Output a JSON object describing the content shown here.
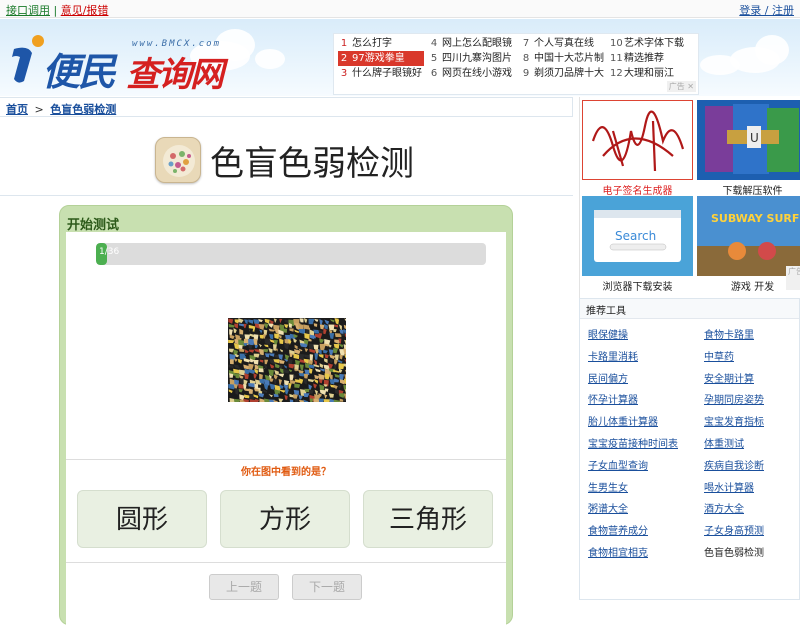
{
  "topbar": {
    "api_label": "接口调用",
    "sep": "|",
    "report_label": "意见/报错",
    "login_label": "登录 / 注册"
  },
  "header": {
    "logo_url_text": "www.BMCX.com",
    "logo_word1": "便民",
    "logo_word2": "查询网",
    "hot": [
      {
        "num": "1",
        "text": "怎么打字"
      },
      {
        "num": "2",
        "text": "97游戏拳皇"
      },
      {
        "num": "3",
        "text": "什么牌子眼镜好"
      },
      {
        "num": "4",
        "text": "网上怎么配眼镜"
      },
      {
        "num": "5",
        "text": "四川九寨沟图片"
      },
      {
        "num": "6",
        "text": "网页在线小游戏"
      },
      {
        "num": "7",
        "text": "个人写真在线"
      },
      {
        "num": "8",
        "text": "中国十大芯片制"
      },
      {
        "num": "9",
        "text": "剃须刀品牌十大"
      },
      {
        "num": "10",
        "text": "艺术字体下载"
      },
      {
        "num": "11",
        "text": "精选推荐"
      },
      {
        "num": "12",
        "text": "大理和丽江"
      }
    ],
    "ad_flag": "广告 ✕"
  },
  "breadcrumb": {
    "home": "首页",
    "sep": ">",
    "current": "色盲色弱检测"
  },
  "page": {
    "title": "色盲色弱检测"
  },
  "test": {
    "heading": "开始测试",
    "progress_text": "1/36",
    "progress_fraction": 0.028,
    "question": "你在图中看到的是？",
    "answers": [
      "圆形",
      "方形",
      "三角形"
    ],
    "prev_label": "上一题",
    "next_label": "下一题"
  },
  "sidebar": {
    "thumbs": [
      {
        "caption": "电子签名生成器",
        "highlight": true
      },
      {
        "caption": "下载解压软件",
        "highlight": false
      },
      {
        "caption": "浏览器下载安装",
        "highlight": false
      },
      {
        "caption": "游戏 开发",
        "highlight": false
      }
    ],
    "browser_search_text": "Search",
    "game_text": "SUBWAY SURFERS",
    "ad_flag": "广告",
    "tools_title": "推荐工具",
    "tools": [
      [
        "眼保健操",
        "食物卡路里"
      ],
      [
        "卡路里消耗",
        "中草药"
      ],
      [
        "民间偏方",
        "安全期计算"
      ],
      [
        "怀孕计算器",
        "孕期同房姿势"
      ],
      [
        "胎儿体重计算器",
        "宝宝发育指标"
      ],
      [
        "宝宝疫苗接种时间表",
        "体重测试"
      ],
      [
        "子女血型查询",
        "疾病自我诊断"
      ],
      [
        "生男生女",
        "喝水计算器"
      ],
      [
        "粥谱大全",
        "酒方大全"
      ],
      [
        "食物营养成分",
        "子女身高预测"
      ],
      [
        "食物相宜相克",
        "色盲色弱检测"
      ]
    ]
  },
  "colors": {
    "accent_green": "#c8e0b0",
    "progress_green": "#4caf50",
    "link_blue": "#1a4f9c",
    "hot_red": "#d9382b"
  }
}
